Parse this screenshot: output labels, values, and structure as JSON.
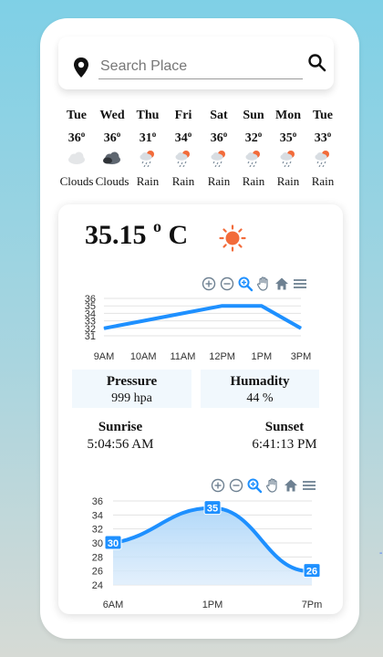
{
  "search": {
    "placeholder": "Search Place",
    "value": ""
  },
  "forecast": [
    {
      "day": "Tue",
      "temp": "36",
      "icon": "clouds-icon",
      "desc": "Clouds"
    },
    {
      "day": "Wed",
      "temp": "36",
      "icon": "clouds-icon",
      "desc": "Clouds"
    },
    {
      "day": "Thu",
      "temp": "31",
      "icon": "rain-icon",
      "desc": "Rain"
    },
    {
      "day": "Fri",
      "temp": "34",
      "icon": "rain-icon",
      "desc": "Rain"
    },
    {
      "day": "Sat",
      "temp": "36",
      "icon": "rain-icon",
      "desc": "Rain"
    },
    {
      "day": "Sun",
      "temp": "32",
      "icon": "rain-icon",
      "desc": "Rain"
    },
    {
      "day": "Mon",
      "temp": "35",
      "icon": "rain-icon",
      "desc": "Rain"
    },
    {
      "day": "Tue",
      "temp": "33",
      "icon": "rain-icon",
      "desc": "Rain"
    }
  ],
  "degree_symbol": "o",
  "current": {
    "temp": "35.15",
    "degree": "o",
    "unit": "C",
    "icon": "sun-icon"
  },
  "pressure": {
    "label": "Pressure",
    "value": "999 hpa"
  },
  "humidity": {
    "label": "Humadity",
    "value": "44 %"
  },
  "sunrise": {
    "label": "Sunrise",
    "value": "5:04:56 AM"
  },
  "sunset": {
    "label": "Sunset",
    "value": "6:41:13 PM"
  },
  "colors": {
    "accent": "#1e90ff",
    "fill": "#bfe1fb",
    "sun": "#f26b3a",
    "stat_bg": "#f1f8fd"
  },
  "toolbar_icons": [
    "zoom-in-icon",
    "zoom-out-icon",
    "zoom-select-icon",
    "pan-hand-icon",
    "home-reset-icon",
    "menu-icon"
  ],
  "stray_mark": "-",
  "chart_data": [
    {
      "type": "line",
      "x": [
        "9AM",
        "10AM",
        "11AM",
        "12PM",
        "1PM",
        "3PM"
      ],
      "series": [
        {
          "values": [
            32,
            33,
            34,
            35,
            35,
            32
          ]
        }
      ],
      "yticks": [
        31,
        32,
        33,
        34,
        35,
        36
      ],
      "ylim": [
        31,
        36
      ],
      "grid": true
    },
    {
      "type": "area",
      "x": [
        "6AM",
        "1PM",
        "7Pm"
      ],
      "series": [
        {
          "values": [
            30,
            35,
            26
          ]
        }
      ],
      "data_labels": [
        "30",
        "35",
        "26"
      ],
      "yticks": [
        24,
        26,
        28,
        30,
        32,
        34,
        36
      ],
      "ylim": [
        24,
        36
      ],
      "grid": true
    }
  ]
}
